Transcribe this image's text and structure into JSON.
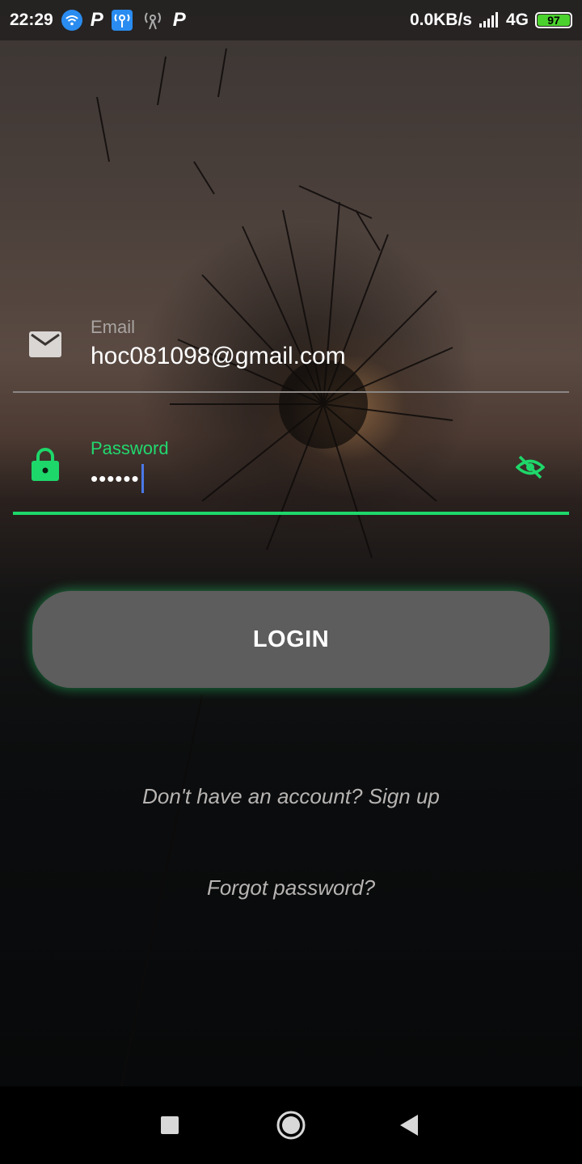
{
  "status_bar": {
    "time": "22:29",
    "network_speed": "0.0KB/s",
    "network_type": "4G",
    "battery_level": "97",
    "left_icons": [
      "wifi-icon",
      "parking-icon",
      "hotspot-icon",
      "signal-tower-icon",
      "parking-icon"
    ],
    "right_icons": [
      "cell-signal-icon",
      "battery-icon"
    ]
  },
  "login_form": {
    "email": {
      "label": "Email",
      "value": "hoc081098@gmail.com",
      "icon": "email-icon"
    },
    "password": {
      "label": "Password",
      "value": "••••••",
      "icon": "lock-icon",
      "toggle_icon": "visibility-off-icon"
    },
    "login_button": "LOGIN",
    "signup_link": "Don't have an account? Sign up",
    "forgot_link": "Forgot password?"
  },
  "nav_bar": {
    "icons": [
      "recents-icon",
      "home-icon",
      "back-icon"
    ]
  },
  "colors": {
    "accent": "#1ed76a",
    "button": "#5d5d5d",
    "battery": "#4cd22e"
  }
}
